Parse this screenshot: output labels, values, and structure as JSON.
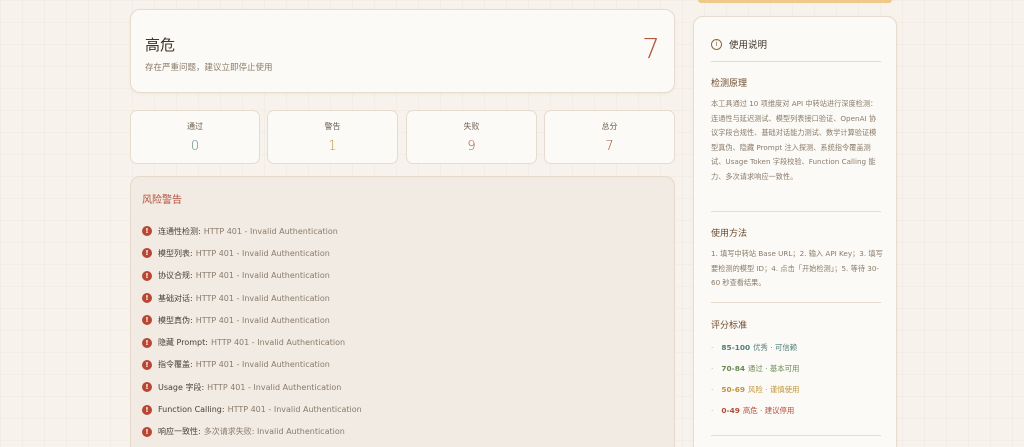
{
  "verdict": {
    "title": "高危",
    "description": "存在严重问题，建议立即停止使用",
    "score": "7"
  },
  "stats": [
    {
      "label": "通过",
      "value": "0",
      "color": "#5f8a8b"
    },
    {
      "label": "警告",
      "value": "1",
      "color": "#b8953a"
    },
    {
      "label": "失败",
      "value": "9",
      "color": "#a8503c"
    },
    {
      "label": "总分",
      "value": "7",
      "color": "#a8503c"
    }
  ],
  "risk": {
    "title": "风险警告",
    "items": [
      {
        "name": "连通性检测",
        "detail": "HTTP 401 - Invalid Authentication"
      },
      {
        "name": "模型列表",
        "detail": "HTTP 401 - Invalid Authentication"
      },
      {
        "name": "协议合规",
        "detail": "HTTP 401 - Invalid Authentication"
      },
      {
        "name": "基础对话",
        "detail": "HTTP 401 - Invalid Authentication"
      },
      {
        "name": "模型真伪",
        "detail": "HTTP 401 - Invalid Authentication"
      },
      {
        "name": "隐藏 Prompt",
        "detail": "HTTP 401 - Invalid Authentication"
      },
      {
        "name": "指令覆盖",
        "detail": "HTTP 401 - Invalid Authentication"
      },
      {
        "name": "Usage 字段",
        "detail": "HTTP 401 - Invalid Authentication"
      },
      {
        "name": "Function Calling",
        "detail": "HTTP 401 - Invalid Authentication"
      },
      {
        "name": "响应一致性",
        "detail": "多次请求失败: Invalid Authentication"
      }
    ]
  },
  "help": {
    "title": "使用说明",
    "principle_title": "检测原理",
    "principle_text": "本工具通过 10 项维度对 API 中转站进行深度检测：连通性与延迟测试、模型列表接口验证、OpenAI 协议字段合规性、基础对话能力测试、数学计算验证模型真伪、隐藏 Prompt 注入探测、系统指令覆盖测试、Usage Token 字段校验、Function Calling 能力、多次请求响应一致性。",
    "usage_title": "使用方法",
    "usage_text": "1. 填写中转站 Base URL；2. 输入 API Key；3. 填写要检测的模型 ID；4. 点击「开始检测」；5. 等待 30-60 秒查看结果。",
    "scoring_title": "评分标准",
    "scoring": [
      {
        "range": "85-100",
        "desc": "优秀 · 可信赖",
        "color": "#4f7f7a"
      },
      {
        "range": "70-84",
        "desc": "通过 · 基本可用",
        "color": "#6b8a55"
      },
      {
        "range": "50-69",
        "desc": "风险 · 谨慎使用",
        "color": "#c0953a"
      },
      {
        "range": "0-49",
        "desc": "高危 · 建议停用",
        "color": "#b34d3a"
      }
    ]
  }
}
